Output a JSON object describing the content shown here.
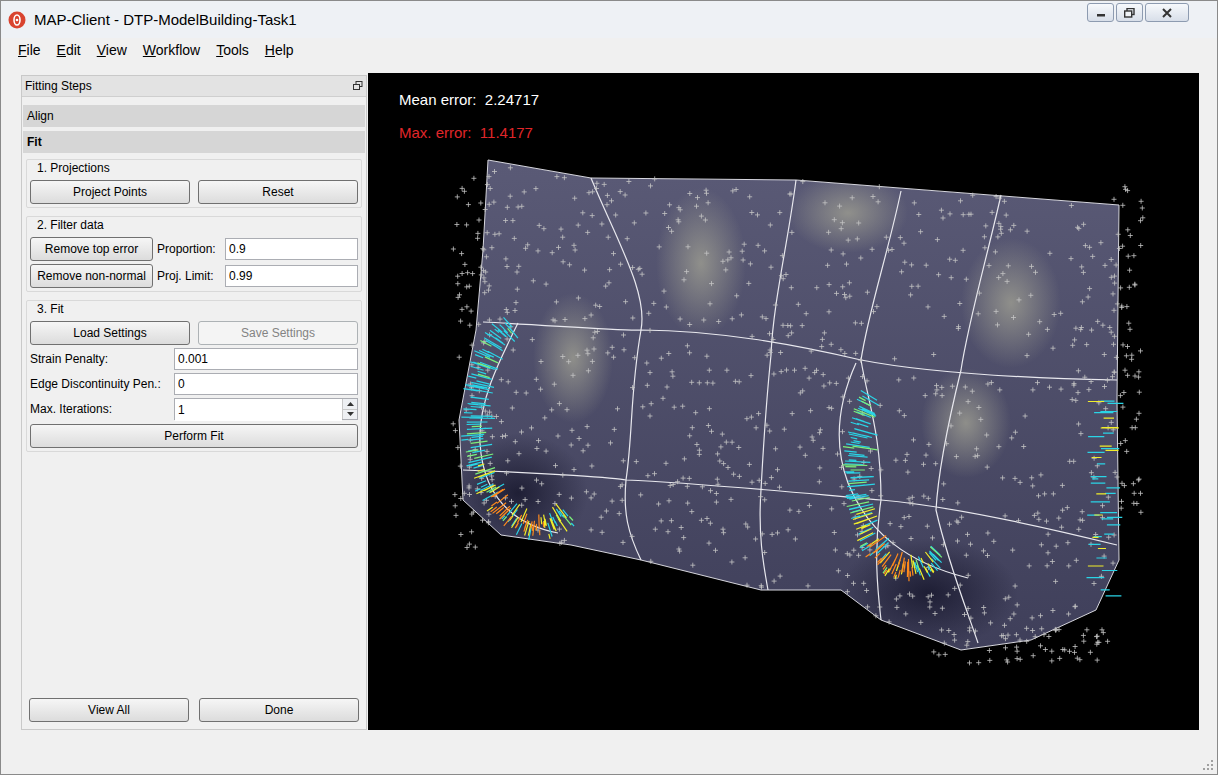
{
  "window": {
    "title": "MAP-Client - DTP-ModelBuilding-Task1"
  },
  "menu": [
    "File",
    "Edit",
    "View",
    "Workflow",
    "Tools",
    "Help"
  ],
  "panel": {
    "title": "Fitting Steps",
    "sections": [
      {
        "label": "Align",
        "selected": false
      },
      {
        "label": "Fit",
        "selected": true
      }
    ]
  },
  "projections": {
    "title": "1. Projections",
    "buttons": [
      {
        "label": "Project Points",
        "disabled": false
      },
      {
        "label": "Reset",
        "disabled": false
      }
    ]
  },
  "filter": {
    "title": "2. Filter data",
    "rows": [
      {
        "button": "Remove top error",
        "label": "Proportion:",
        "value": "0.9"
      },
      {
        "button": "Remove non-normal",
        "label": "Proj. Limit:",
        "value": "0.99"
      }
    ]
  },
  "fit": {
    "title": "3. Fit",
    "buttons": [
      {
        "label": "Load Settings",
        "disabled": false
      },
      {
        "label": "Save Settings",
        "disabled": true
      }
    ],
    "fields": [
      {
        "label": "Strain Penalty:",
        "value": "0.001",
        "kind": "text"
      },
      {
        "label": "Edge Discontinuity Pen.:",
        "value": "0",
        "kind": "text"
      },
      {
        "label": "Max. Iterations:",
        "value": "1",
        "kind": "spin"
      }
    ],
    "action": "Perform Fit"
  },
  "footer": {
    "buttons": [
      "View All",
      "Done"
    ]
  },
  "viewport": {
    "mean_error": "Mean error:  2.24717",
    "max_error": "Max. error:  11.4177"
  }
}
